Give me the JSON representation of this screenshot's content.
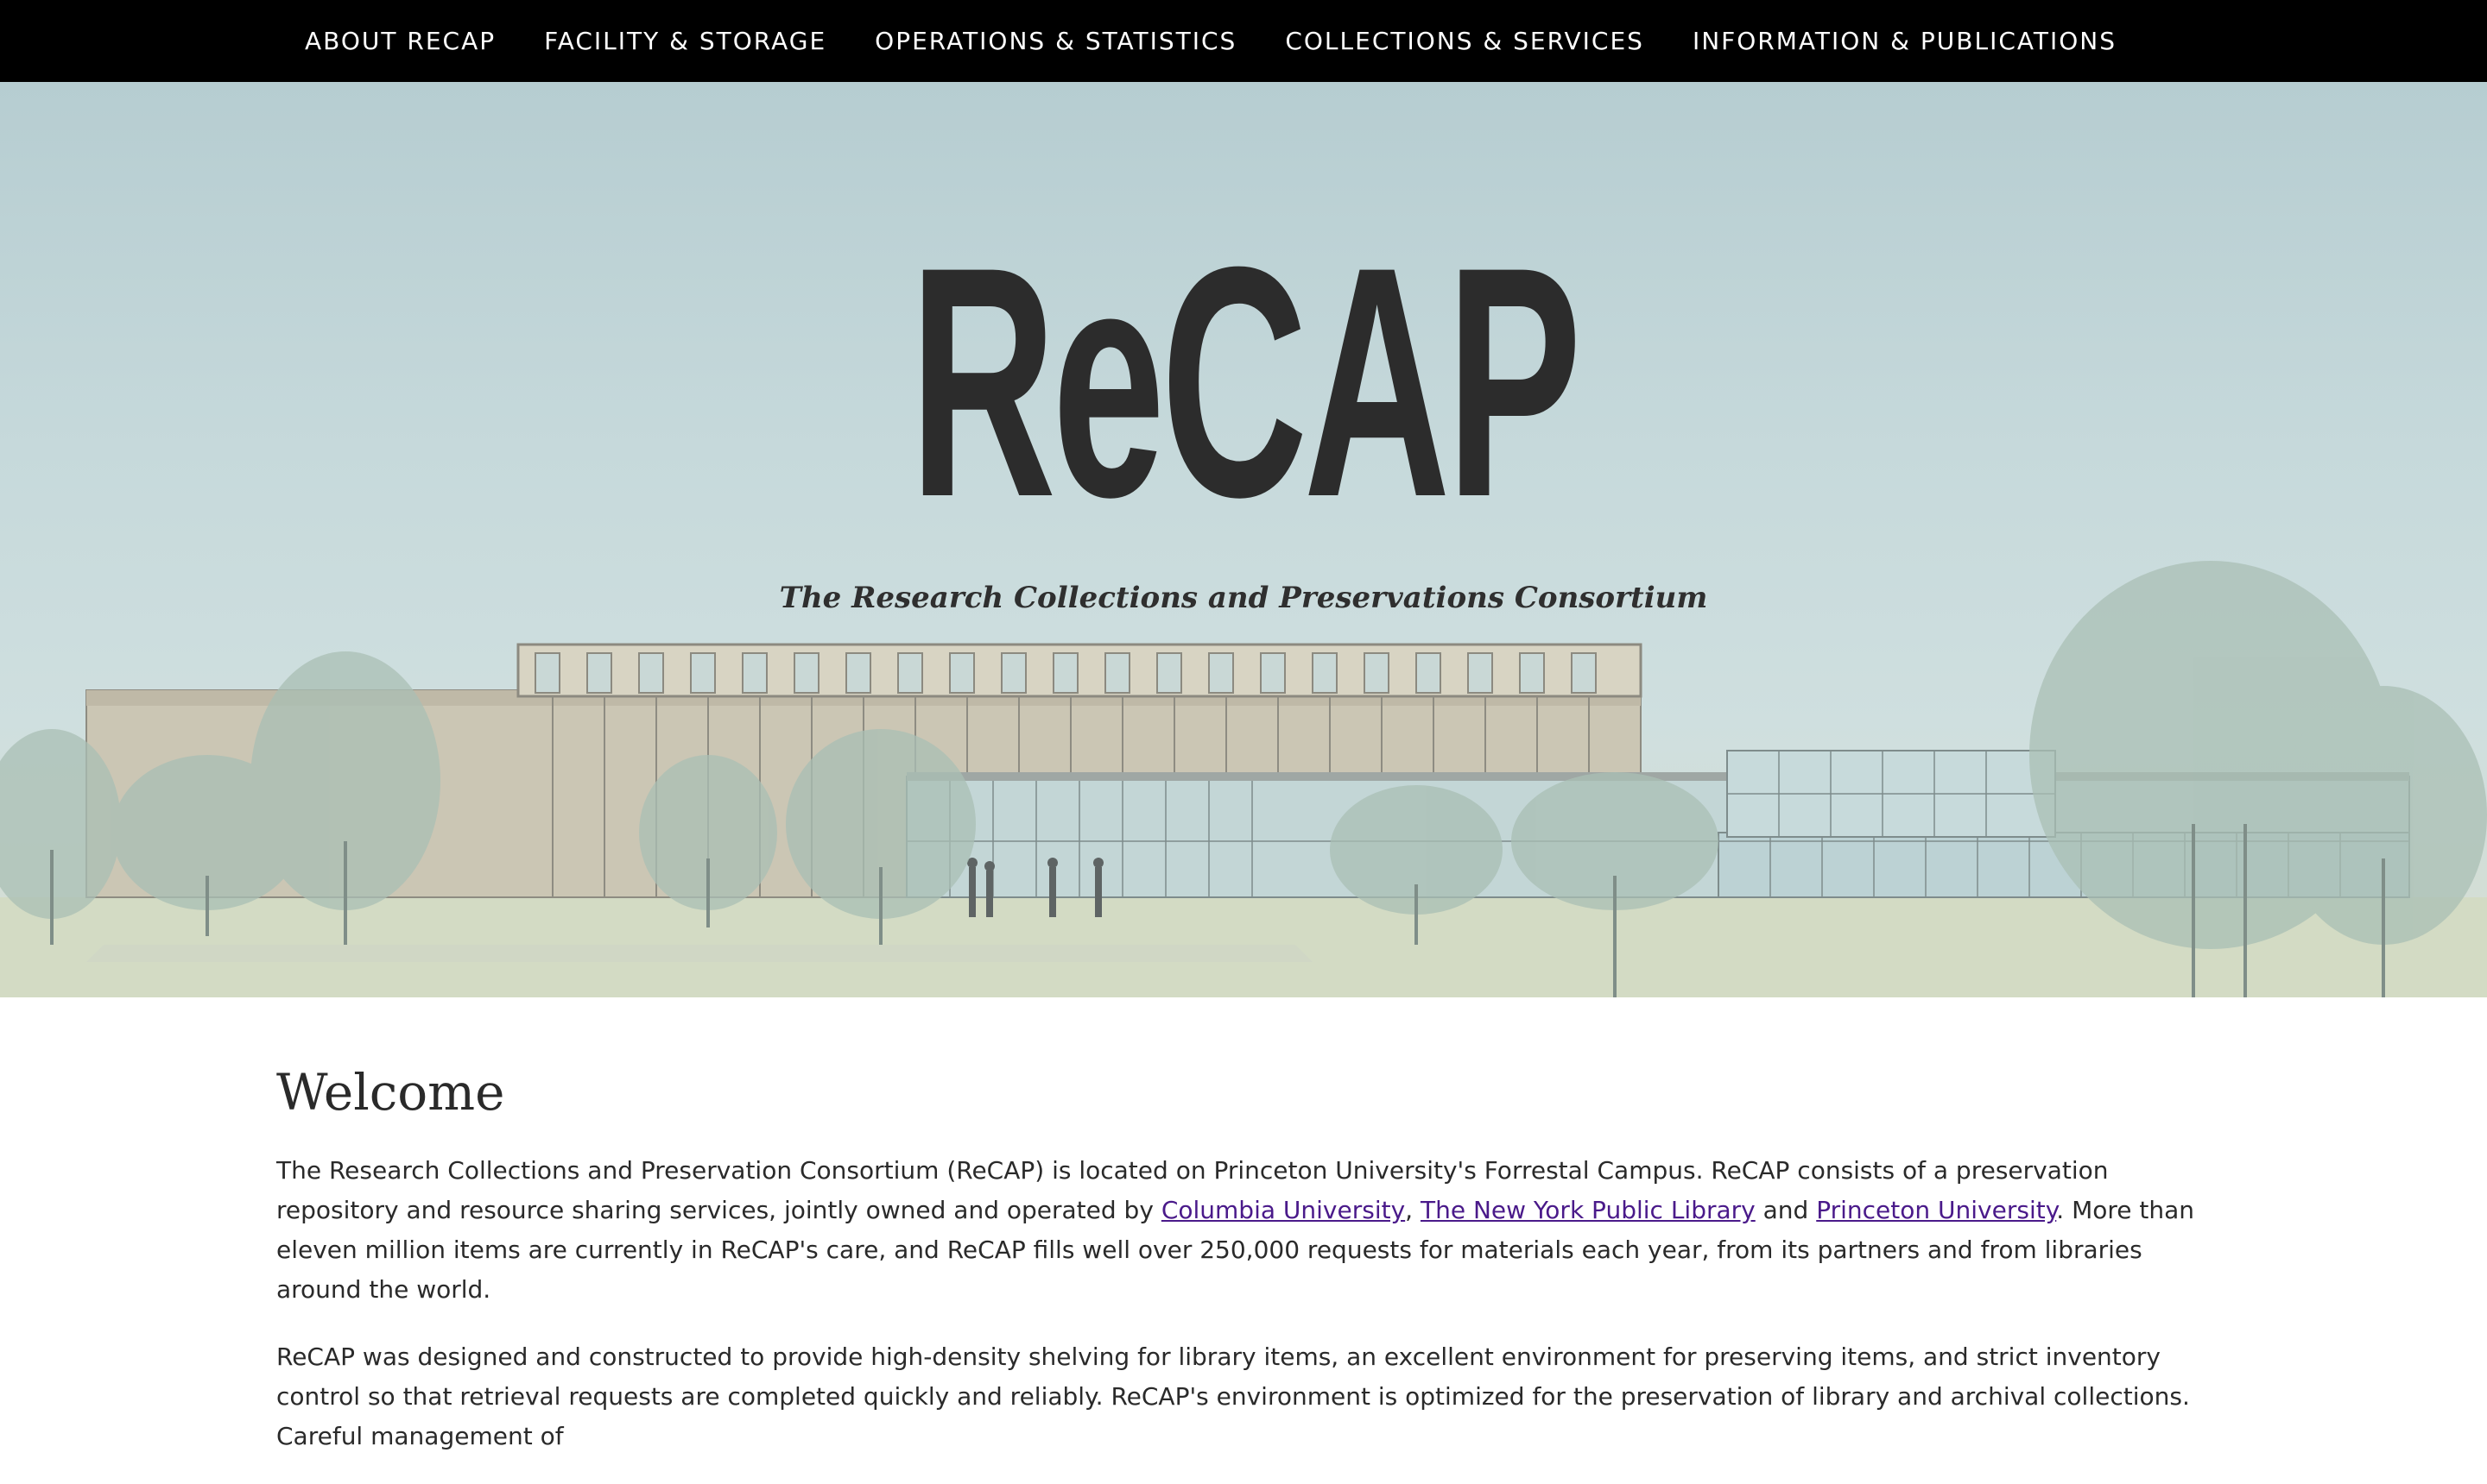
{
  "nav": {
    "items": [
      {
        "label": "ABOUT RECAP"
      },
      {
        "label": "FACILITY & STORAGE"
      },
      {
        "label": "OPERATIONS & STATISTICS"
      },
      {
        "label": "COLLECTIONS & SERVICES"
      },
      {
        "label": "INFORMATION & PUBLICATIONS"
      }
    ]
  },
  "hero": {
    "title": "ReCAP",
    "tagline": "The Research Collections and Preservations Consortium"
  },
  "main": {
    "heading": "Welcome",
    "p1": {
      "lead": "The Research Collections and Preservation Consortium (ReCAP) is located on Princeton University's Forrestal Campus. ReCAP consists of a preservation repository and resource sharing services, jointly owned and operated by ",
      "link1": "Columbia University",
      "sep1": ", ",
      "link2": "The New York Public Library",
      "sep2": " and ",
      "link3": "Princeton University",
      "tail": ". More than eleven million items are currently in ReCAP's care, and ReCAP fills well over 250,000 requests for materials each year, from its partners and from libraries around the world."
    },
    "p2": "ReCAP was designed and constructed to provide high-density shelving for library items, an excellent environment for preserving items, and strict inventory control so that retrieval requests are completed quickly and reliably. ReCAP's environment is optimized for the preservation of library and archival collections. Careful management of"
  },
  "colors": {
    "nav_bg": "#000000",
    "nav_text": "#ffffff",
    "link": "#4a1a8a",
    "title": "#2c2c2c"
  }
}
